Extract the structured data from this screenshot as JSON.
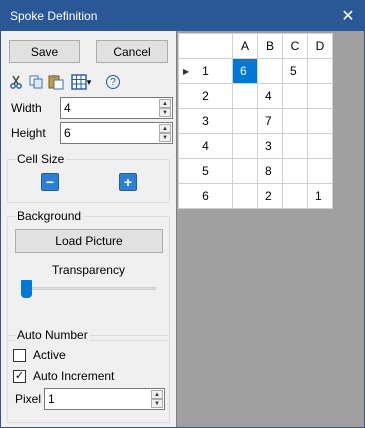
{
  "window": {
    "title": "Spoke Definition",
    "close_glyph": "✕"
  },
  "buttons": {
    "save": "Save",
    "cancel": "Cancel"
  },
  "toolbar": {
    "icons": [
      "scissors-icon",
      "copy-icon",
      "paste-icon",
      "table-icon",
      "help-icon"
    ],
    "dropdown_glyph": "▾",
    "help_glyph": "?"
  },
  "fields": {
    "width": {
      "label": "Width",
      "value": "4"
    },
    "height": {
      "label": "Height",
      "value": "6"
    },
    "pixel": {
      "label": "Pixel",
      "value": "1"
    }
  },
  "cell_size": {
    "title": "Cell Size",
    "minus": "−",
    "plus": "+"
  },
  "background": {
    "title": "Background",
    "load_picture": "Load Picture",
    "transparency_label": "Transparency",
    "transparency_value": 0
  },
  "auto_number": {
    "title": "Auto Number",
    "active": {
      "label": "Active",
      "checked": false
    },
    "auto_increment": {
      "label": "Auto Increment",
      "checked": true,
      "check_glyph": "✓"
    }
  },
  "grid": {
    "columns": [
      "A",
      "B",
      "C",
      "D"
    ],
    "rows": [
      {
        "label": "1",
        "cells": [
          "6",
          "",
          "5",
          ""
        ]
      },
      {
        "label": "2",
        "cells": [
          "",
          "4",
          "",
          ""
        ]
      },
      {
        "label": "3",
        "cells": [
          "",
          "7",
          "",
          ""
        ]
      },
      {
        "label": "4",
        "cells": [
          "",
          "3",
          "",
          ""
        ]
      },
      {
        "label": "5",
        "cells": [
          "",
          "8",
          "",
          ""
        ]
      },
      {
        "label": "6",
        "cells": [
          "",
          "2",
          "",
          "1"
        ]
      }
    ],
    "current_row_marker": "▶",
    "selected": {
      "row": 0,
      "col": 0
    }
  },
  "colors": {
    "titlebar": "#2b5797",
    "accent": "#0078d7",
    "size_button": "#2d7fd3"
  }
}
